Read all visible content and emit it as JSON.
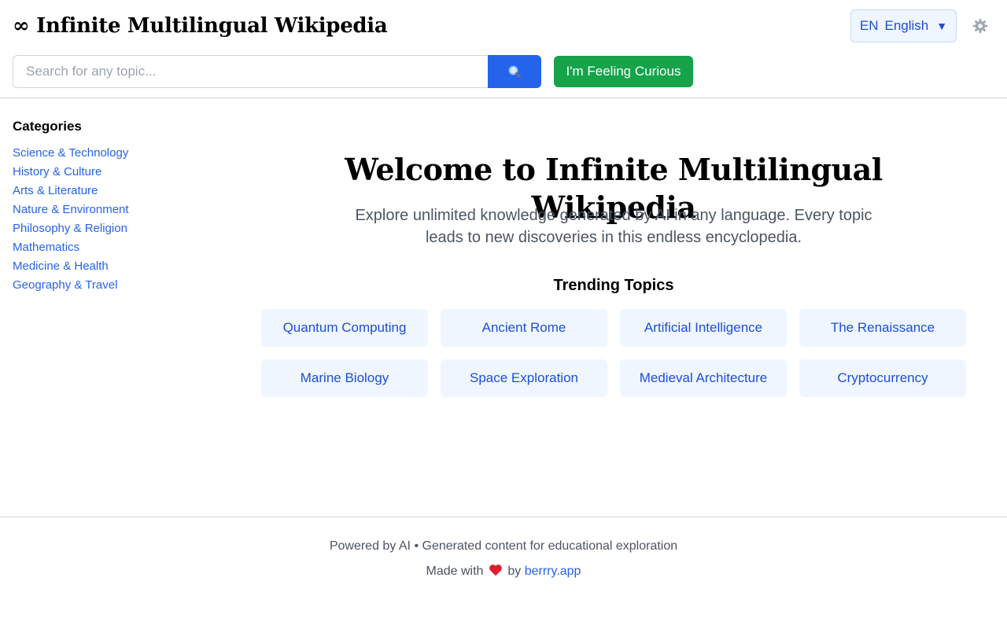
{
  "header": {
    "logo_symbol": "∞",
    "title": "Infinite Multilingual Wikipedia",
    "language": {
      "code": "EN",
      "name": "English",
      "chevron": "▼"
    },
    "settings_icon": "gear-icon",
    "search": {
      "placeholder": "Search for any topic...",
      "value": "",
      "button_icon": "search-icon"
    },
    "curious_label": "I'm Feeling Curious"
  },
  "sidebar": {
    "title": "Categories",
    "items": [
      {
        "label": "Science & Technology"
      },
      {
        "label": "History & Culture"
      },
      {
        "label": "Arts & Literature"
      },
      {
        "label": "Nature & Environment"
      },
      {
        "label": "Philosophy & Religion"
      },
      {
        "label": "Mathematics"
      },
      {
        "label": "Medicine & Health"
      },
      {
        "label": "Geography & Travel"
      }
    ]
  },
  "main": {
    "welcome_title": "Welcome to Infinite Multilingual Wikipedia",
    "intro": "Explore unlimited knowledge generated by AI in any language. Every topic leads to new discoveries in this endless encyclopedia.",
    "trending_title": "Trending Topics",
    "topics": [
      {
        "label": "Quantum Computing"
      },
      {
        "label": "Ancient Rome"
      },
      {
        "label": "Artificial Intelligence"
      },
      {
        "label": "The Renaissance"
      },
      {
        "label": "Marine Biology"
      },
      {
        "label": "Space Exploration"
      },
      {
        "label": "Medieval Architecture"
      },
      {
        "label": "Cryptocurrency"
      }
    ]
  },
  "footer": {
    "line1": "Powered by AI • Generated content for educational exploration",
    "made_with": "Made with",
    "by": "by",
    "link": "berrry.app",
    "heart_icon": "heart-icon"
  },
  "colors": {
    "link": "#2563eb",
    "primary": "#2563eb",
    "success": "#16a34a",
    "chip_bg": "#eff6ff",
    "chip_text": "#1d4ed8"
  }
}
